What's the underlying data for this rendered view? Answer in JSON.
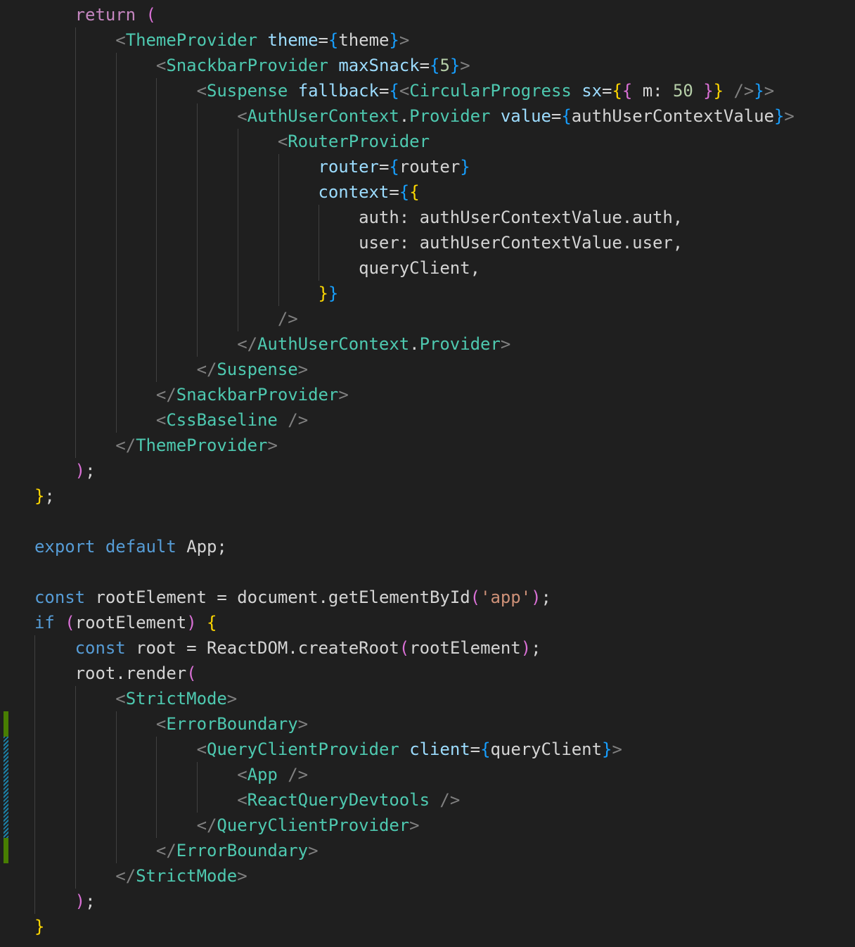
{
  "editor": {
    "language": "tsx",
    "lines": [
      [
        [
          "    ",
          "txt"
        ],
        [
          "return",
          "ctl"
        ],
        [
          " ",
          "txt"
        ],
        [
          "(",
          "b2"
        ]
      ],
      [
        [
          "        ",
          "txt"
        ],
        [
          "<",
          "punc"
        ],
        [
          "ThemeProvider",
          "cmp"
        ],
        [
          " ",
          "txt"
        ],
        [
          "theme",
          "attr"
        ],
        [
          "=",
          "txt"
        ],
        [
          "{",
          "b3"
        ],
        [
          "theme",
          "txt"
        ],
        [
          "}",
          "b3"
        ],
        [
          ">",
          "punc"
        ]
      ],
      [
        [
          "            ",
          "txt"
        ],
        [
          "<",
          "punc"
        ],
        [
          "SnackbarProvider",
          "cmp"
        ],
        [
          " ",
          "txt"
        ],
        [
          "maxSnack",
          "attr"
        ],
        [
          "=",
          "txt"
        ],
        [
          "{",
          "b3"
        ],
        [
          "5",
          "num"
        ],
        [
          "}",
          "b3"
        ],
        [
          ">",
          "punc"
        ]
      ],
      [
        [
          "                ",
          "txt"
        ],
        [
          "<",
          "punc"
        ],
        [
          "Suspense",
          "cmp"
        ],
        [
          " ",
          "txt"
        ],
        [
          "fallback",
          "attr"
        ],
        [
          "=",
          "txt"
        ],
        [
          "{",
          "b3"
        ],
        [
          "<",
          "punc"
        ],
        [
          "CircularProgress",
          "cmp"
        ],
        [
          " ",
          "txt"
        ],
        [
          "sx",
          "attr"
        ],
        [
          "=",
          "txt"
        ],
        [
          "{",
          "b1"
        ],
        [
          "{",
          "b2"
        ],
        [
          " m: ",
          "txt"
        ],
        [
          "50",
          "num"
        ],
        [
          " ",
          "txt"
        ],
        [
          "}",
          "b2"
        ],
        [
          "}",
          "b1"
        ],
        [
          " ",
          "txt"
        ],
        [
          "/>",
          "punc"
        ],
        [
          "}",
          "b3"
        ],
        [
          ">",
          "punc"
        ]
      ],
      [
        [
          "                    ",
          "txt"
        ],
        [
          "<",
          "punc"
        ],
        [
          "AuthUserContext",
          "cmp"
        ],
        [
          ".",
          "txt"
        ],
        [
          "Provider",
          "cmp"
        ],
        [
          " ",
          "txt"
        ],
        [
          "value",
          "attr"
        ],
        [
          "=",
          "txt"
        ],
        [
          "{",
          "b3"
        ],
        [
          "authUserContextValue",
          "txt"
        ],
        [
          "}",
          "b3"
        ],
        [
          ">",
          "punc"
        ]
      ],
      [
        [
          "                        ",
          "txt"
        ],
        [
          "<",
          "punc"
        ],
        [
          "RouterProvider",
          "cmp"
        ]
      ],
      [
        [
          "                            ",
          "txt"
        ],
        [
          "router",
          "attr"
        ],
        [
          "=",
          "txt"
        ],
        [
          "{",
          "b3"
        ],
        [
          "router",
          "txt"
        ],
        [
          "}",
          "b3"
        ]
      ],
      [
        [
          "                            ",
          "txt"
        ],
        [
          "context",
          "attr"
        ],
        [
          "=",
          "txt"
        ],
        [
          "{",
          "b3"
        ],
        [
          "{",
          "b1"
        ]
      ],
      [
        [
          "                                ",
          "txt"
        ],
        [
          "auth: authUserContextValue.auth,",
          "txt"
        ]
      ],
      [
        [
          "                                ",
          "txt"
        ],
        [
          "user: authUserContextValue.user,",
          "txt"
        ]
      ],
      [
        [
          "                                ",
          "txt"
        ],
        [
          "queryClient,",
          "txt"
        ]
      ],
      [
        [
          "                            ",
          "txt"
        ],
        [
          "}",
          "b1"
        ],
        [
          "}",
          "b3"
        ]
      ],
      [
        [
          "                        ",
          "txt"
        ],
        [
          "/>",
          "punc"
        ]
      ],
      [
        [
          "                    ",
          "txt"
        ],
        [
          "</",
          "punc"
        ],
        [
          "AuthUserContext",
          "cmp"
        ],
        [
          ".",
          "txt"
        ],
        [
          "Provider",
          "cmp"
        ],
        [
          ">",
          "punc"
        ]
      ],
      [
        [
          "                ",
          "txt"
        ],
        [
          "</",
          "punc"
        ],
        [
          "Suspense",
          "cmp"
        ],
        [
          ">",
          "punc"
        ]
      ],
      [
        [
          "            ",
          "txt"
        ],
        [
          "</",
          "punc"
        ],
        [
          "SnackbarProvider",
          "cmp"
        ],
        [
          ">",
          "punc"
        ]
      ],
      [
        [
          "            ",
          "txt"
        ],
        [
          "<",
          "punc"
        ],
        [
          "CssBaseline",
          "cmp"
        ],
        [
          " ",
          "txt"
        ],
        [
          "/>",
          "punc"
        ]
      ],
      [
        [
          "        ",
          "txt"
        ],
        [
          "</",
          "punc"
        ],
        [
          "ThemeProvider",
          "cmp"
        ],
        [
          ">",
          "punc"
        ]
      ],
      [
        [
          "    ",
          "txt"
        ],
        [
          ")",
          "b2"
        ],
        [
          ";",
          "txt"
        ]
      ],
      [
        [
          "}",
          "b1"
        ],
        [
          ";",
          "txt"
        ]
      ],
      [],
      [
        [
          "export",
          "kw"
        ],
        [
          " ",
          "txt"
        ],
        [
          "default",
          "kw"
        ],
        [
          " ",
          "txt"
        ],
        [
          "App",
          "txt"
        ],
        [
          ";",
          "txt"
        ]
      ],
      [],
      [
        [
          "const",
          "kw"
        ],
        [
          " ",
          "txt"
        ],
        [
          "rootElement",
          "txt"
        ],
        [
          " = ",
          "txt"
        ],
        [
          "document",
          "txt"
        ],
        [
          ".",
          "txt"
        ],
        [
          "getElementById",
          "txt"
        ],
        [
          "(",
          "b2"
        ],
        [
          "'app'",
          "str"
        ],
        [
          ")",
          "b2"
        ],
        [
          ";",
          "txt"
        ]
      ],
      [
        [
          "if",
          "kw"
        ],
        [
          " ",
          "txt"
        ],
        [
          "(",
          "b2"
        ],
        [
          "rootElement",
          "txt"
        ],
        [
          ")",
          "b2"
        ],
        [
          " ",
          "txt"
        ],
        [
          "{",
          "b1"
        ]
      ],
      [
        [
          "    ",
          "txt"
        ],
        [
          "const",
          "kw"
        ],
        [
          " ",
          "txt"
        ],
        [
          "root",
          "txt"
        ],
        [
          " = ",
          "txt"
        ],
        [
          "ReactDOM",
          "txt"
        ],
        [
          ".",
          "txt"
        ],
        [
          "createRoot",
          "txt"
        ],
        [
          "(",
          "b2"
        ],
        [
          "rootElement",
          "txt"
        ],
        [
          ")",
          "b2"
        ],
        [
          ";",
          "txt"
        ]
      ],
      [
        [
          "    ",
          "txt"
        ],
        [
          "root",
          "txt"
        ],
        [
          ".",
          "txt"
        ],
        [
          "render",
          "txt"
        ],
        [
          "(",
          "b2"
        ]
      ],
      [
        [
          "        ",
          "txt"
        ],
        [
          "<",
          "punc"
        ],
        [
          "StrictMode",
          "cmp"
        ],
        [
          ">",
          "punc"
        ]
      ],
      [
        [
          "            ",
          "txt"
        ],
        [
          "<",
          "punc"
        ],
        [
          "ErrorBoundary",
          "cmp"
        ],
        [
          ">",
          "punc"
        ]
      ],
      [
        [
          "                ",
          "txt"
        ],
        [
          "<",
          "punc"
        ],
        [
          "QueryClientProvider",
          "cmp"
        ],
        [
          " ",
          "txt"
        ],
        [
          "client",
          "attr"
        ],
        [
          "=",
          "txt"
        ],
        [
          "{",
          "b3"
        ],
        [
          "queryClient",
          "txt"
        ],
        [
          "}",
          "b3"
        ],
        [
          ">",
          "punc"
        ]
      ],
      [
        [
          "                    ",
          "txt"
        ],
        [
          "<",
          "punc"
        ],
        [
          "App",
          "cmp"
        ],
        [
          " ",
          "txt"
        ],
        [
          "/>",
          "punc"
        ]
      ],
      [
        [
          "                    ",
          "txt"
        ],
        [
          "<",
          "punc"
        ],
        [
          "ReactQueryDevtools",
          "cmp"
        ],
        [
          " ",
          "txt"
        ],
        [
          "/>",
          "punc"
        ]
      ],
      [
        [
          "                ",
          "txt"
        ],
        [
          "</",
          "punc"
        ],
        [
          "QueryClientProvider",
          "cmp"
        ],
        [
          ">",
          "punc"
        ]
      ],
      [
        [
          "            ",
          "txt"
        ],
        [
          "</",
          "punc"
        ],
        [
          "ErrorBoundary",
          "cmp"
        ],
        [
          ">",
          "punc"
        ]
      ],
      [
        [
          "        ",
          "txt"
        ],
        [
          "</",
          "punc"
        ],
        [
          "StrictMode",
          "cmp"
        ],
        [
          ">",
          "punc"
        ]
      ],
      [
        [
          "    ",
          "txt"
        ],
        [
          ")",
          "b2"
        ],
        [
          ";",
          "txt"
        ]
      ],
      [
        [
          "}",
          "b1"
        ]
      ]
    ],
    "gutter_marks": [
      {
        "kind": "added",
        "from_line": 28,
        "to_line": 28
      },
      {
        "kind": "modified",
        "from_line": 29,
        "to_line": 32
      },
      {
        "kind": "added",
        "from_line": 33,
        "to_line": 33
      }
    ],
    "indent_guides": [
      {
        "level": 1,
        "from_line": 1,
        "to_line": 17
      },
      {
        "level": 2,
        "from_line": 2,
        "to_line": 16
      },
      {
        "level": 3,
        "from_line": 3,
        "to_line": 14
      },
      {
        "level": 4,
        "from_line": 4,
        "to_line": 13
      },
      {
        "level": 5,
        "from_line": 5,
        "to_line": 12
      },
      {
        "level": 6,
        "from_line": 6,
        "to_line": 11
      },
      {
        "level": 7,
        "from_line": 8,
        "to_line": 10
      },
      {
        "level": 0,
        "from_line": 25,
        "to_line": 35
      },
      {
        "level": 1,
        "from_line": 27,
        "to_line": 34
      },
      {
        "level": 2,
        "from_line": 28,
        "to_line": 33
      },
      {
        "level": 3,
        "from_line": 29,
        "to_line": 32
      },
      {
        "level": 4,
        "from_line": 30,
        "to_line": 31
      }
    ]
  }
}
